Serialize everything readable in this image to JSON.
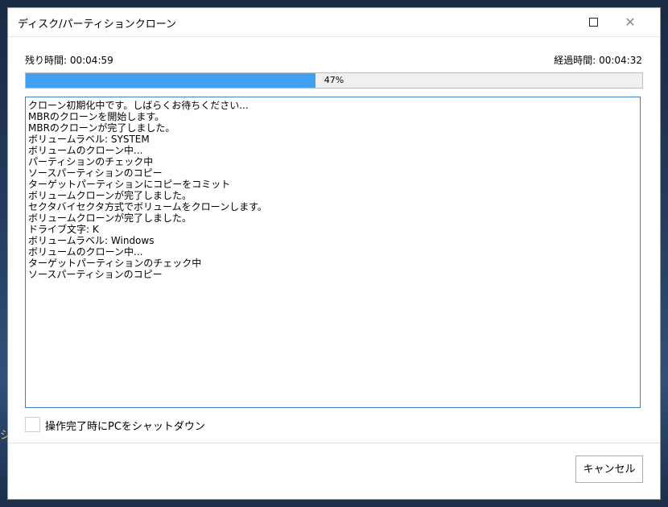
{
  "window": {
    "title": "ディスク/パーティションクローン",
    "close_glyph": "✕"
  },
  "status": {
    "remaining_label": "残り時間: 00:04:59",
    "elapsed_label": "経過時間: 00:04:32"
  },
  "progress": {
    "percent": 47,
    "text": "47%",
    "fill_color": "#42a0f0"
  },
  "log": {
    "lines": [
      "クローン初期化中です。しばらくお待ちください...",
      "MBRのクローンを開始します。",
      "MBRのクローンが完了しました。",
      "ボリュームラベル: SYSTEM",
      "ボリュームのクローン中...",
      "パーティションのチェック中",
      "ソースパーティションのコピー",
      "ターゲットパーティションにコピーをコミット",
      "ボリュームクローンが完了しました。",
      "セクタバイセクタ方式でボリュームをクローンします。",
      "ボリュームクローンが完了しました。",
      "ドライブ文字: K",
      "ボリュームラベル: Windows",
      "ボリュームのクローン中...",
      "ターゲットパーティションのチェック中",
      "ソースパーティションのコピー"
    ]
  },
  "options": {
    "shutdown_label": "操作完了時にPCをシャットダウン",
    "shutdown_checked": false
  },
  "footer": {
    "cancel_label": "キャンセル"
  }
}
